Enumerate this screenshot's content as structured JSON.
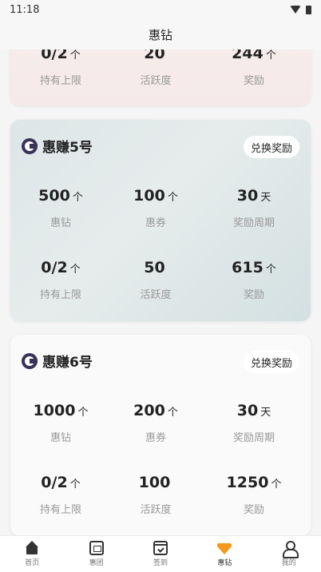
{
  "status_bar": {
    "time": "11:18"
  },
  "header": {
    "title": "惠钻"
  },
  "cards": [
    {
      "name": "",
      "stats": [
        {
          "value": "0/2",
          "unit": "个",
          "label": "持有上限"
        },
        {
          "value": "20",
          "unit": "",
          "label": "活跃度"
        },
        {
          "value": "244",
          "unit": "个",
          "label": "奖励"
        }
      ]
    },
    {
      "name": "惠赚5号",
      "button": "兑换奖励",
      "stats": [
        {
          "value": "500",
          "unit": "个",
          "label": "惠钻"
        },
        {
          "value": "100",
          "unit": "个",
          "label": "惠券"
        },
        {
          "value": "30",
          "unit": "天",
          "label": "奖励周期"
        },
        {
          "value": "0/2",
          "unit": "个",
          "label": "持有上限"
        },
        {
          "value": "50",
          "unit": "",
          "label": "活跃度"
        },
        {
          "value": "615",
          "unit": "个",
          "label": "奖励"
        }
      ]
    },
    {
      "name": "惠赚6号",
      "button": "兑换奖励",
      "stats": [
        {
          "value": "1000",
          "unit": "个",
          "label": "惠钻"
        },
        {
          "value": "200",
          "unit": "个",
          "label": "惠券"
        },
        {
          "value": "30",
          "unit": "天",
          "label": "奖励周期"
        },
        {
          "value": "0/2",
          "unit": "个",
          "label": "持有上限"
        },
        {
          "value": "100",
          "unit": "",
          "label": "活跃度"
        },
        {
          "value": "1250",
          "unit": "个",
          "label": "奖励"
        }
      ]
    }
  ],
  "tabs": [
    {
      "label": "首页",
      "icon": "home-icon"
    },
    {
      "label": "惠团",
      "icon": "group-icon"
    },
    {
      "label": "签到",
      "icon": "calendar-icon"
    },
    {
      "label": "惠钻",
      "icon": "diamond-icon",
      "active": true
    },
    {
      "label": "我的",
      "icon": "user-icon"
    }
  ],
  "colors": {
    "accent": "#f39a1e",
    "logo": "#3a3358"
  }
}
